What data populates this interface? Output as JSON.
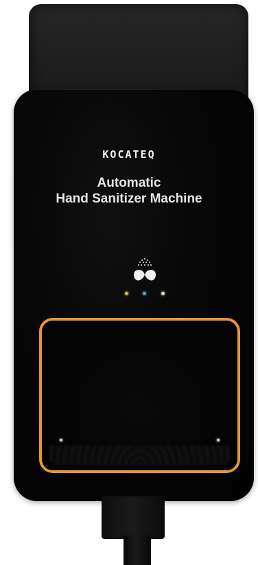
{
  "device": {
    "brand": "KOCATEQ",
    "title_line1": "Automatic",
    "title_line2": "Hand Sanitizer Machine",
    "icon": "hands-spray-icon",
    "indicator_colors": [
      "#d8b55a",
      "#4fa7c9",
      "#e7d9b8"
    ],
    "sensor_border_color": "#e79634"
  }
}
